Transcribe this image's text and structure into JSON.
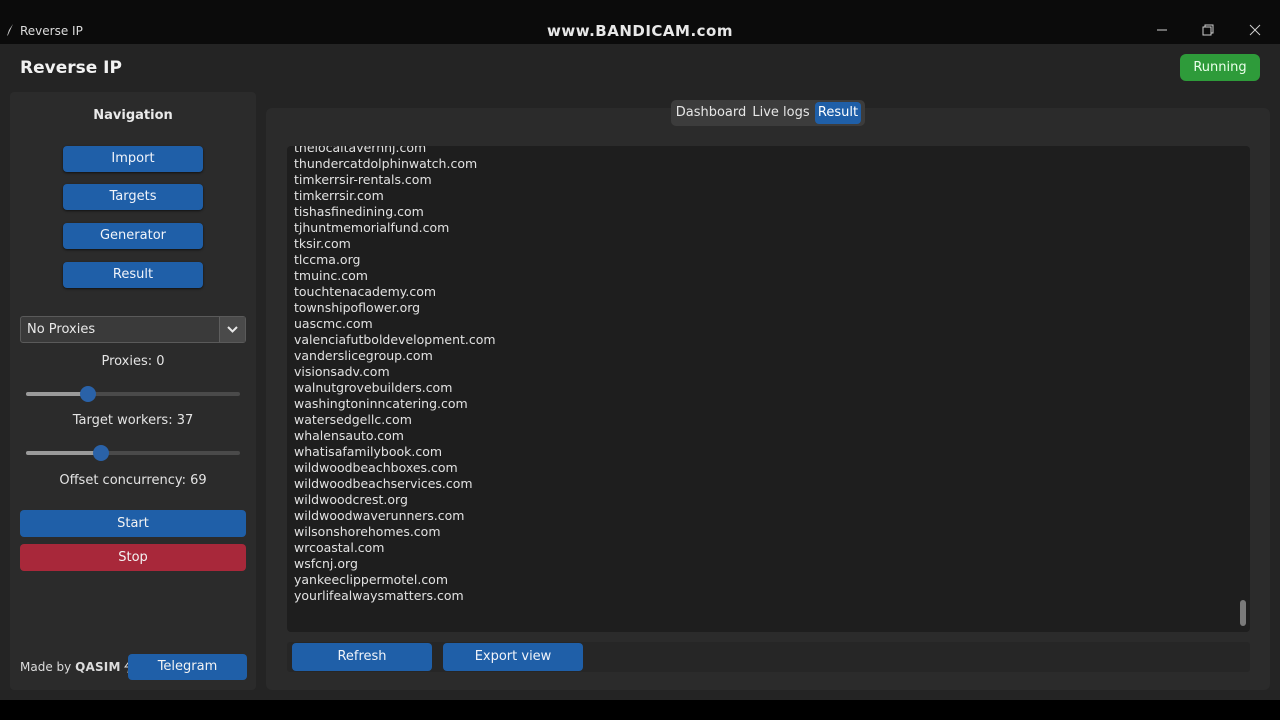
{
  "window": {
    "title": "Reverse IP",
    "watermark": "www.BANDICAM.com",
    "controls": [
      "minimize-icon",
      "restore-icon",
      "close-icon"
    ]
  },
  "header": {
    "title": "Reverse IP",
    "status": "Running",
    "status_color": "#2e9b3a"
  },
  "sidebar": {
    "nav_title": "Navigation",
    "nav_items": [
      "Import",
      "Targets",
      "Generator",
      "Result"
    ],
    "proxy_select": {
      "value": "No Proxies"
    },
    "proxies_label": "Proxies: 0",
    "proxies_slider_fraction": 0.29,
    "target_workers_label": "Target workers: 37",
    "target_workers_slider_fraction": 0.35,
    "offset_concurrency_label": "Offset concurrency: 69",
    "start_label": "Start",
    "stop_label": "Stop",
    "made_by": {
      "prefix": "Made by",
      "brand": "QASIM"
    },
    "telegram_label": "Telegram"
  },
  "tabs": [
    {
      "label": "Dashboard",
      "active": false
    },
    {
      "label": "Live logs",
      "active": false
    },
    {
      "label": "Result",
      "active": true
    }
  ],
  "results": [
    "thelocaltavernnj.com",
    "thundercatdolphinwatch.com",
    "timkerrsir-rentals.com",
    "timkerrsir.com",
    "tishasfinedining.com",
    "tjhuntmemorialfund.com",
    "tksir.com",
    "tlccma.org",
    "tmuinc.com",
    "touchtenacademy.com",
    "townshipoflower.org",
    "uascmc.com",
    "valenciafutboldevelopment.com",
    "vanderslicegroup.com",
    "visionsadv.com",
    "walnutgrovebuilders.com",
    "washingtoninncatering.com",
    "watersedgellc.com",
    "whalensauto.com",
    "whatisafamilybook.com",
    "wildwoodbeachboxes.com",
    "wildwoodbeachservices.com",
    "wildwoodcrest.org",
    "wildwoodwaverunners.com",
    "wilsonshorehomes.com",
    "wrcoastal.com",
    "wsfcnj.org",
    "yankeeclippermotel.com",
    "yourlifealwaysmatters.com"
  ],
  "actions": {
    "refresh": "Refresh",
    "export": "Export view"
  },
  "colors": {
    "accent": "#1f5fa8",
    "danger": "#a8283a",
    "success": "#2e9b3a"
  }
}
